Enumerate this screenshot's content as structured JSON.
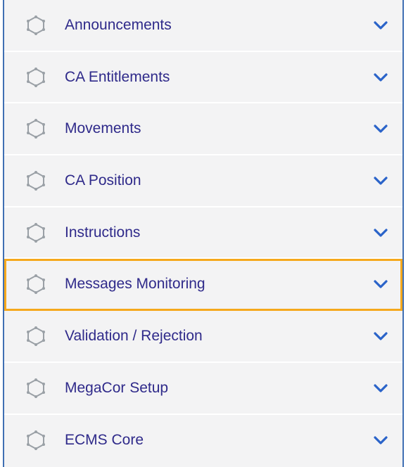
{
  "colors": {
    "panel_background": "#f3f3f4",
    "panel_border": "#3f6fb3",
    "label_text": "#2f2a8a",
    "icon_stroke": "#9aa0a6",
    "chevron": "#2a63c9",
    "highlight_outline": "#f5a81c"
  },
  "menu": {
    "items": [
      {
        "label": "Announcements",
        "icon": "hexagon-outline-icon",
        "chevron": "chevron-down-icon",
        "highlighted": false
      },
      {
        "label": "CA Entitlements",
        "icon": "hexagon-outline-icon",
        "chevron": "chevron-down-icon",
        "highlighted": false
      },
      {
        "label": "Movements",
        "icon": "hexagon-outline-icon",
        "chevron": "chevron-down-icon",
        "highlighted": false
      },
      {
        "label": "CA Position",
        "icon": "hexagon-outline-icon",
        "chevron": "chevron-down-icon",
        "highlighted": false
      },
      {
        "label": "Instructions",
        "icon": "hexagon-outline-icon",
        "chevron": "chevron-down-icon",
        "highlighted": false
      },
      {
        "label": "Messages Monitoring",
        "icon": "hexagon-outline-icon",
        "chevron": "chevron-down-icon",
        "highlighted": true
      },
      {
        "label": "Validation / Rejection",
        "icon": "hexagon-outline-icon",
        "chevron": "chevron-down-icon",
        "highlighted": false
      },
      {
        "label": "MegaCor Setup",
        "icon": "hexagon-outline-icon",
        "chevron": "chevron-down-icon",
        "highlighted": false
      },
      {
        "label": "ECMS Core",
        "icon": "hexagon-outline-icon",
        "chevron": "chevron-down-icon",
        "highlighted": false
      }
    ]
  }
}
